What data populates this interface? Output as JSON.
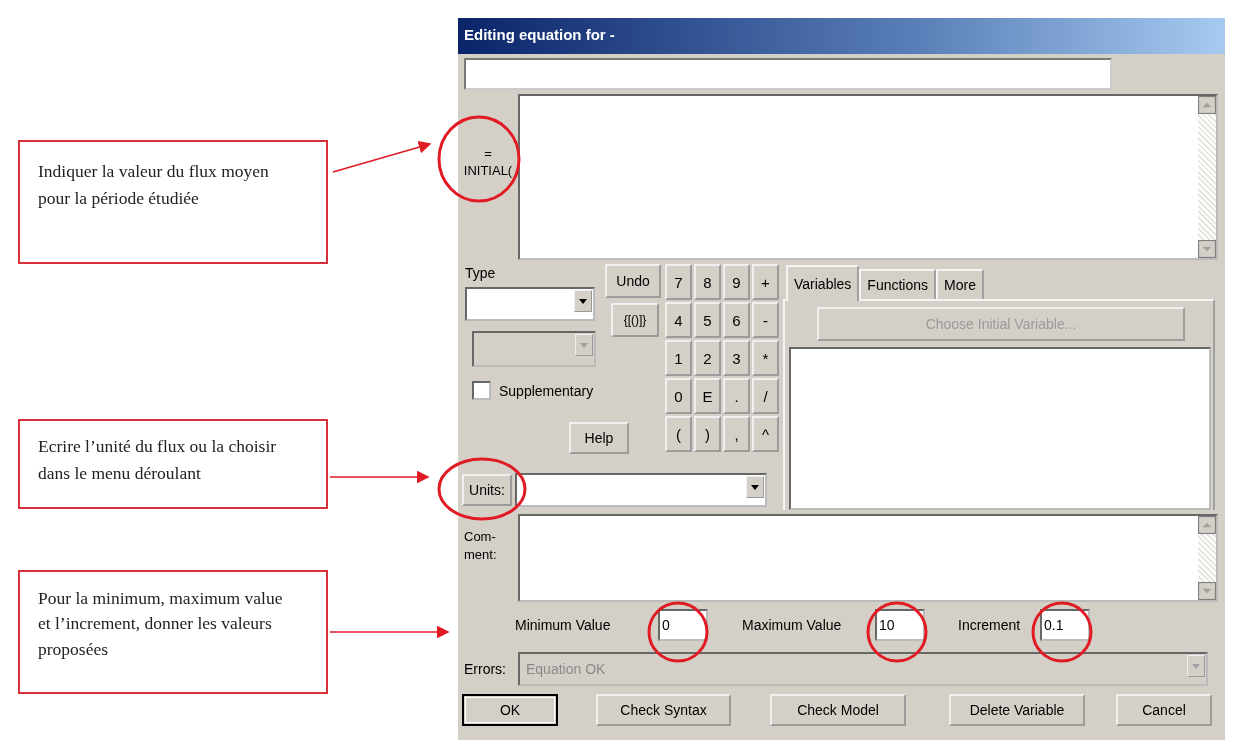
{
  "annotations": [
    {
      "text": "Indiquer la valeur du flux moyen  pour la période étudiée"
    },
    {
      "text": "Ecrire l’unité du flux ou la choisir dans le menu déroulant"
    },
    {
      "text": "Pour la minimum, maximum value et l’increment, donner les valeurs proposées"
    }
  ],
  "dialog": {
    "title": "Editing equation for -",
    "equation": {
      "prefix_lines": [
        "=",
        "INITIAL("
      ]
    },
    "type": {
      "label": "Type"
    },
    "supplementary": {
      "label": "Supplementary",
      "checked": false
    },
    "undo_button": "Undo",
    "brackets_button": "{[()]}",
    "help_button": "Help",
    "keypad": [
      "7",
      "8",
      "9",
      "+",
      "4",
      "5",
      "6",
      "-",
      "1",
      "2",
      "3",
      "*",
      "0",
      "E",
      ".",
      "/",
      "(",
      ")",
      ",",
      "^"
    ],
    "tabs": [
      {
        "label": "Variables",
        "selected": true
      },
      {
        "label": "Functions",
        "selected": false
      },
      {
        "label": "More",
        "selected": false
      }
    ],
    "choose_button": {
      "label": "Choose Initial Variable...",
      "disabled": true
    },
    "units_button": "Units:",
    "comment_label": [
      "Com-",
      "ment:"
    ],
    "range_fields": [
      {
        "label": "Minimum Value",
        "value": "0"
      },
      {
        "label": "Maximum Value",
        "value": "10"
      },
      {
        "label": "Increment",
        "value": "0.1"
      }
    ],
    "errors": {
      "label": "Errors:",
      "value": "Equation OK",
      "disabled": true
    },
    "buttons": [
      {
        "label": "OK",
        "default": true
      },
      {
        "label": "Check Syntax",
        "default": false
      },
      {
        "label": "Check Model",
        "default": false
      },
      {
        "label": "Delete Variable",
        "default": false
      },
      {
        "label": "Cancel",
        "default": false
      }
    ]
  }
}
